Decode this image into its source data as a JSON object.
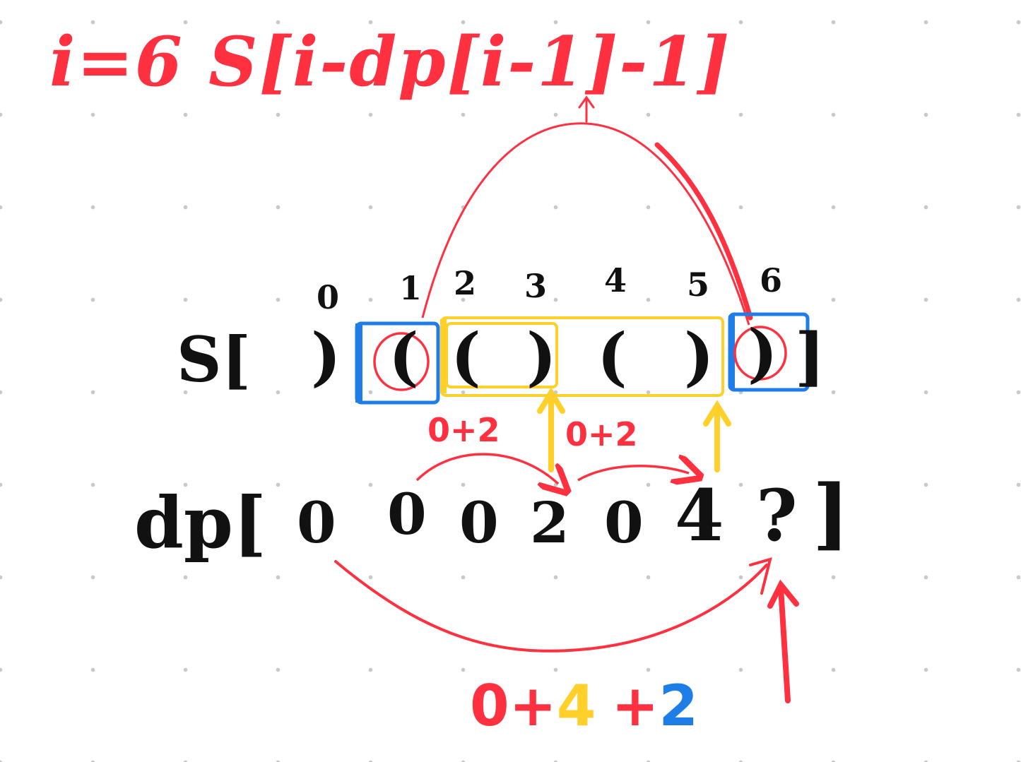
{
  "colors": {
    "red": "#ff3040",
    "black": "#111111",
    "blue": "#1e7de6",
    "yellow": "#ffd02a",
    "grid_dot": "#c9c9c9"
  },
  "formula": "i=6 S[i-dp[i-1]-1]",
  "indices": [
    "0",
    "1",
    "2",
    "3",
    "4",
    "5",
    "6"
  ],
  "s_label": "S[",
  "s_chars": [
    ")",
    "(",
    "(",
    ")",
    "(",
    ")",
    ")"
  ],
  "s_close": "]",
  "dp_label": "dp[",
  "dp_values": [
    "0",
    "0",
    "0",
    "2",
    "0",
    "4",
    "?"
  ],
  "dp_close": "]",
  "step_notes": [
    "0+2",
    "0+2"
  ],
  "sum": {
    "parts": [
      "0+",
      "4",
      "+",
      "2"
    ],
    "colors": [
      "red",
      "yellow",
      "red",
      "blue"
    ]
  }
}
